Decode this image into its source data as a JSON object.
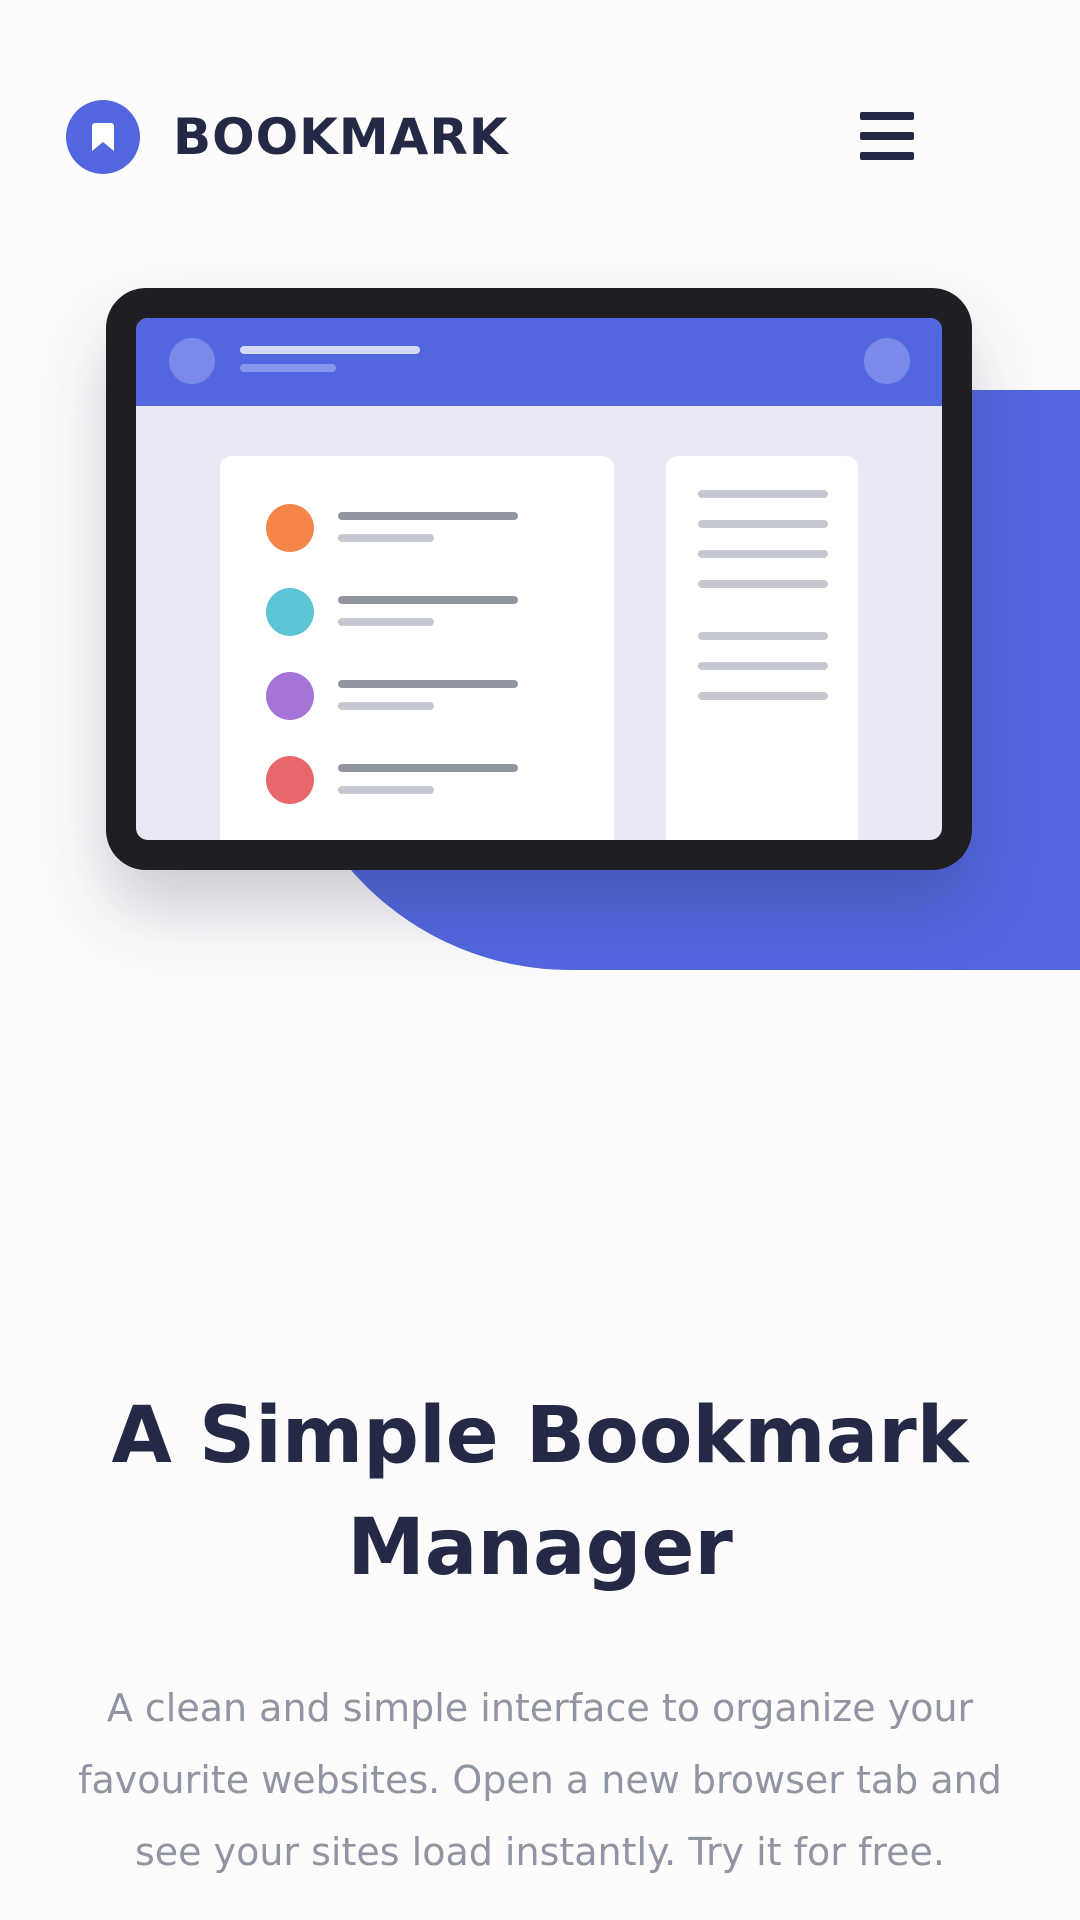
{
  "header": {
    "logo_text": "BOOKMARK",
    "logo_icon": "bookmark-icon",
    "menu_icon": "hamburger-menu-icon"
  },
  "hero": {
    "title": "A Simple Bookmark Manager",
    "description": "A clean and simple interface to organize your favourite websites. Open a new browser tab and see your sites load instantly. Try it for free."
  },
  "colors": {
    "brand_blue": "#5267df",
    "dark_navy": "#242a45",
    "grey_text": "#9194a2",
    "dot_orange": "#f5854b",
    "dot_teal": "#5bc5d3",
    "dot_purple": "#a475d6",
    "dot_red": "#e8676a"
  }
}
